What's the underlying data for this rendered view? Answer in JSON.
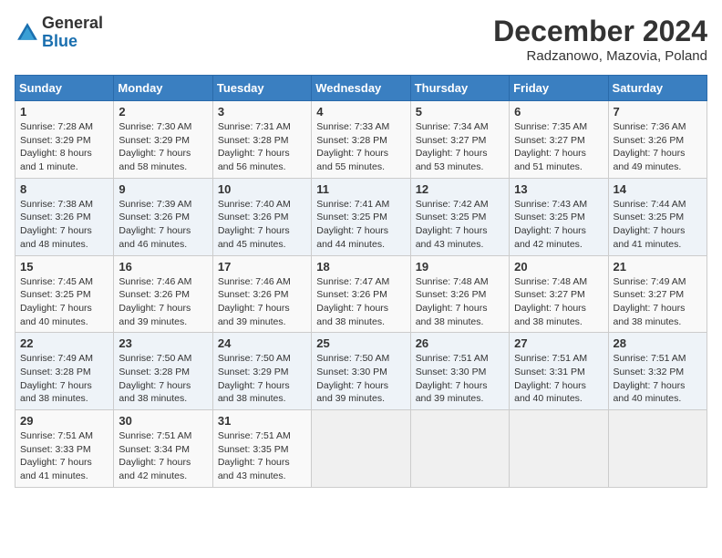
{
  "header": {
    "logo_general": "General",
    "logo_blue": "Blue",
    "month_year": "December 2024",
    "location": "Radzanowo, Mazovia, Poland"
  },
  "weekdays": [
    "Sunday",
    "Monday",
    "Tuesday",
    "Wednesday",
    "Thursday",
    "Friday",
    "Saturday"
  ],
  "weeks": [
    [
      {
        "day": "1",
        "sunrise": "Sunrise: 7:28 AM",
        "sunset": "Sunset: 3:29 PM",
        "daylight": "Daylight: 8 hours and 1 minute."
      },
      {
        "day": "2",
        "sunrise": "Sunrise: 7:30 AM",
        "sunset": "Sunset: 3:29 PM",
        "daylight": "Daylight: 7 hours and 58 minutes."
      },
      {
        "day": "3",
        "sunrise": "Sunrise: 7:31 AM",
        "sunset": "Sunset: 3:28 PM",
        "daylight": "Daylight: 7 hours and 56 minutes."
      },
      {
        "day": "4",
        "sunrise": "Sunrise: 7:33 AM",
        "sunset": "Sunset: 3:28 PM",
        "daylight": "Daylight: 7 hours and 55 minutes."
      },
      {
        "day": "5",
        "sunrise": "Sunrise: 7:34 AM",
        "sunset": "Sunset: 3:27 PM",
        "daylight": "Daylight: 7 hours and 53 minutes."
      },
      {
        "day": "6",
        "sunrise": "Sunrise: 7:35 AM",
        "sunset": "Sunset: 3:27 PM",
        "daylight": "Daylight: 7 hours and 51 minutes."
      },
      {
        "day": "7",
        "sunrise": "Sunrise: 7:36 AM",
        "sunset": "Sunset: 3:26 PM",
        "daylight": "Daylight: 7 hours and 49 minutes."
      }
    ],
    [
      {
        "day": "8",
        "sunrise": "Sunrise: 7:38 AM",
        "sunset": "Sunset: 3:26 PM",
        "daylight": "Daylight: 7 hours and 48 minutes."
      },
      {
        "day": "9",
        "sunrise": "Sunrise: 7:39 AM",
        "sunset": "Sunset: 3:26 PM",
        "daylight": "Daylight: 7 hours and 46 minutes."
      },
      {
        "day": "10",
        "sunrise": "Sunrise: 7:40 AM",
        "sunset": "Sunset: 3:26 PM",
        "daylight": "Daylight: 7 hours and 45 minutes."
      },
      {
        "day": "11",
        "sunrise": "Sunrise: 7:41 AM",
        "sunset": "Sunset: 3:25 PM",
        "daylight": "Daylight: 7 hours and 44 minutes."
      },
      {
        "day": "12",
        "sunrise": "Sunrise: 7:42 AM",
        "sunset": "Sunset: 3:25 PM",
        "daylight": "Daylight: 7 hours and 43 minutes."
      },
      {
        "day": "13",
        "sunrise": "Sunrise: 7:43 AM",
        "sunset": "Sunset: 3:25 PM",
        "daylight": "Daylight: 7 hours and 42 minutes."
      },
      {
        "day": "14",
        "sunrise": "Sunrise: 7:44 AM",
        "sunset": "Sunset: 3:25 PM",
        "daylight": "Daylight: 7 hours and 41 minutes."
      }
    ],
    [
      {
        "day": "15",
        "sunrise": "Sunrise: 7:45 AM",
        "sunset": "Sunset: 3:25 PM",
        "daylight": "Daylight: 7 hours and 40 minutes."
      },
      {
        "day": "16",
        "sunrise": "Sunrise: 7:46 AM",
        "sunset": "Sunset: 3:26 PM",
        "daylight": "Daylight: 7 hours and 39 minutes."
      },
      {
        "day": "17",
        "sunrise": "Sunrise: 7:46 AM",
        "sunset": "Sunset: 3:26 PM",
        "daylight": "Daylight: 7 hours and 39 minutes."
      },
      {
        "day": "18",
        "sunrise": "Sunrise: 7:47 AM",
        "sunset": "Sunset: 3:26 PM",
        "daylight": "Daylight: 7 hours and 38 minutes."
      },
      {
        "day": "19",
        "sunrise": "Sunrise: 7:48 AM",
        "sunset": "Sunset: 3:26 PM",
        "daylight": "Daylight: 7 hours and 38 minutes."
      },
      {
        "day": "20",
        "sunrise": "Sunrise: 7:48 AM",
        "sunset": "Sunset: 3:27 PM",
        "daylight": "Daylight: 7 hours and 38 minutes."
      },
      {
        "day": "21",
        "sunrise": "Sunrise: 7:49 AM",
        "sunset": "Sunset: 3:27 PM",
        "daylight": "Daylight: 7 hours and 38 minutes."
      }
    ],
    [
      {
        "day": "22",
        "sunrise": "Sunrise: 7:49 AM",
        "sunset": "Sunset: 3:28 PM",
        "daylight": "Daylight: 7 hours and 38 minutes."
      },
      {
        "day": "23",
        "sunrise": "Sunrise: 7:50 AM",
        "sunset": "Sunset: 3:28 PM",
        "daylight": "Daylight: 7 hours and 38 minutes."
      },
      {
        "day": "24",
        "sunrise": "Sunrise: 7:50 AM",
        "sunset": "Sunset: 3:29 PM",
        "daylight": "Daylight: 7 hours and 38 minutes."
      },
      {
        "day": "25",
        "sunrise": "Sunrise: 7:50 AM",
        "sunset": "Sunset: 3:30 PM",
        "daylight": "Daylight: 7 hours and 39 minutes."
      },
      {
        "day": "26",
        "sunrise": "Sunrise: 7:51 AM",
        "sunset": "Sunset: 3:30 PM",
        "daylight": "Daylight: 7 hours and 39 minutes."
      },
      {
        "day": "27",
        "sunrise": "Sunrise: 7:51 AM",
        "sunset": "Sunset: 3:31 PM",
        "daylight": "Daylight: 7 hours and 40 minutes."
      },
      {
        "day": "28",
        "sunrise": "Sunrise: 7:51 AM",
        "sunset": "Sunset: 3:32 PM",
        "daylight": "Daylight: 7 hours and 40 minutes."
      }
    ],
    [
      {
        "day": "29",
        "sunrise": "Sunrise: 7:51 AM",
        "sunset": "Sunset: 3:33 PM",
        "daylight": "Daylight: 7 hours and 41 minutes."
      },
      {
        "day": "30",
        "sunrise": "Sunrise: 7:51 AM",
        "sunset": "Sunset: 3:34 PM",
        "daylight": "Daylight: 7 hours and 42 minutes."
      },
      {
        "day": "31",
        "sunrise": "Sunrise: 7:51 AM",
        "sunset": "Sunset: 3:35 PM",
        "daylight": "Daylight: 7 hours and 43 minutes."
      },
      null,
      null,
      null,
      null
    ]
  ]
}
